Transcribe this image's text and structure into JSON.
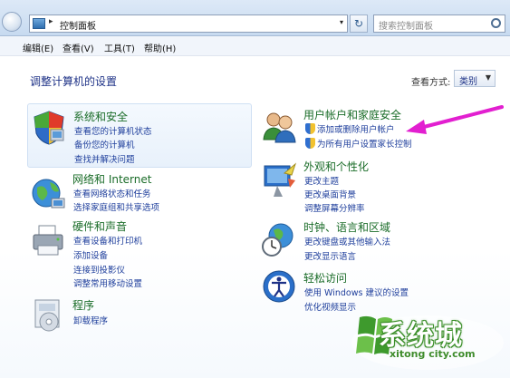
{
  "address": {
    "breadcrumb": "控制面板",
    "search_placeholder": "搜索控制面板"
  },
  "menu": {
    "items": [
      "编辑(E)",
      "查看(V)",
      "工具(T)",
      "帮助(H)"
    ]
  },
  "page": {
    "title": "调整计算机的设置",
    "view_label": "查看方式:",
    "view_value": "类别"
  },
  "categories": {
    "system": {
      "title": "系统和安全",
      "links": [
        "查看您的计算机状态",
        "备份您的计算机",
        "查找并解决问题"
      ]
    },
    "network": {
      "title": "网络和 Internet",
      "links": [
        "查看网络状态和任务",
        "选择家庭组和共享选项"
      ]
    },
    "hardware": {
      "title": "硬件和声音",
      "links": [
        "查看设备和打印机",
        "添加设备",
        "连接到投影仪",
        "调整常用移动设置"
      ]
    },
    "programs": {
      "title": "程序",
      "links": [
        "卸载程序"
      ]
    },
    "accounts": {
      "title": "用户帐户和家庭安全",
      "links": [
        "添加或删除用户帐户",
        "为所有用户设置家长控制"
      ]
    },
    "appearance": {
      "title": "外观和个性化",
      "links": [
        "更改主题",
        "更改桌面背景",
        "调整屏幕分辨率"
      ]
    },
    "clock": {
      "title": "时钟、语言和区域",
      "links": [
        "更改键盘或其他输入法",
        "更改显示语言"
      ]
    },
    "access": {
      "title": "轻松访问",
      "links": [
        "使用 Windows 建议的设置",
        "优化视频显示"
      ]
    }
  },
  "watermark": {
    "text": "系统城",
    "url": "xitong city.com"
  },
  "colors": {
    "link": "#1f3f9c",
    "category_title": "#1a6c28",
    "annotation_arrow": "#e21fd0"
  }
}
